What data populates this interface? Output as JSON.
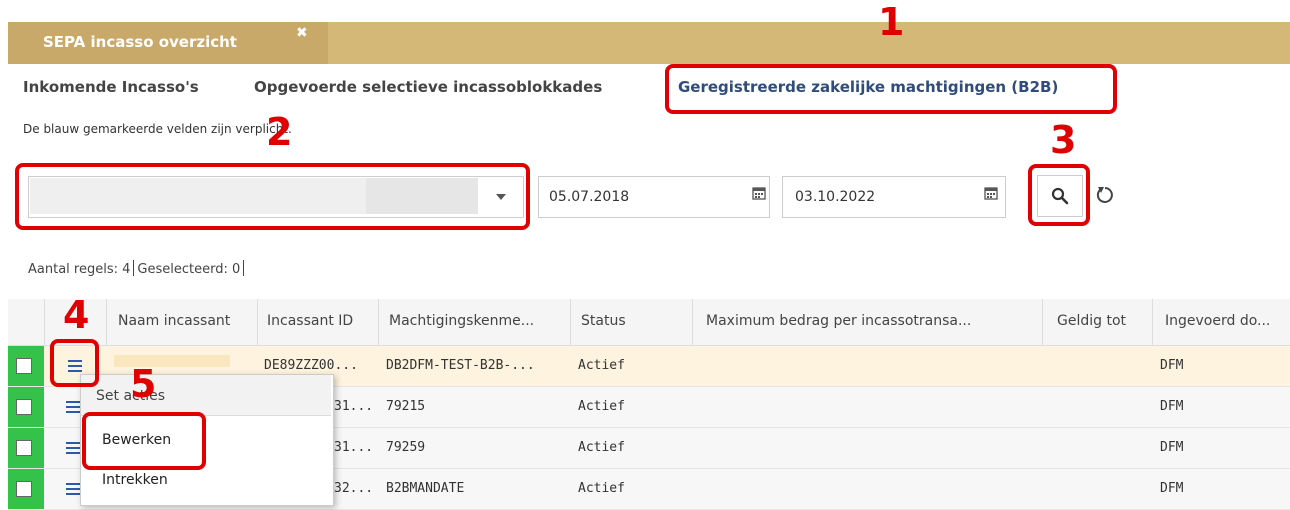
{
  "header": {
    "tab_title": "SEPA incasso overzicht",
    "close": "✖"
  },
  "subtabs": [
    {
      "label": "Inkomende Incasso's"
    },
    {
      "label": "Opgevoerde selectieve incassoblokkades"
    },
    {
      "label": "Geregistreerde zakelijke machtigingen (B2B)"
    }
  ],
  "hint": "De blauw gemarkeerde velden zijn verplicht.",
  "filters": {
    "date_from": "05.07.2018",
    "date_to": "03.10.2022"
  },
  "counts": {
    "rows_label": "Aantal regels: 4",
    "selected_label": "Geselecteerd: 0"
  },
  "table": {
    "columns": [
      "Naam incassant",
      "Incassant ID",
      "Machtigingskenme...",
      "Status",
      "Maximum bedrag per incassotransa...",
      "Geldig tot",
      "Ingevoerd do..."
    ],
    "rows": [
      {
        "id": "DE89ZZZ00...",
        "ref": "DB2DFM-TEST-B2B-...",
        "status": "Actief",
        "by": "DFM"
      },
      {
        "id": "31...",
        "ref": "79215",
        "status": "Actief",
        "by": "DFM"
      },
      {
        "id": "31...",
        "ref": "79259",
        "status": "Actief",
        "by": "DFM"
      },
      {
        "id": "32...",
        "ref": "B2BMANDATE",
        "status": "Actief",
        "by": "DFM"
      }
    ]
  },
  "context_menu": {
    "header": "Set acties",
    "items": [
      "Bewerken",
      "Intrekken"
    ]
  },
  "annotations": [
    "1",
    "2",
    "3",
    "4",
    "5"
  ],
  "colors": {
    "header": "#d4b877",
    "active_tab": "#2f4c7a",
    "annotation": "#e00000",
    "check_column": "#35c24a"
  },
  "icons": [
    "close-icon",
    "dropdown-caret-icon",
    "calendar-icon",
    "search-icon",
    "refresh-icon",
    "menu-icon"
  ]
}
